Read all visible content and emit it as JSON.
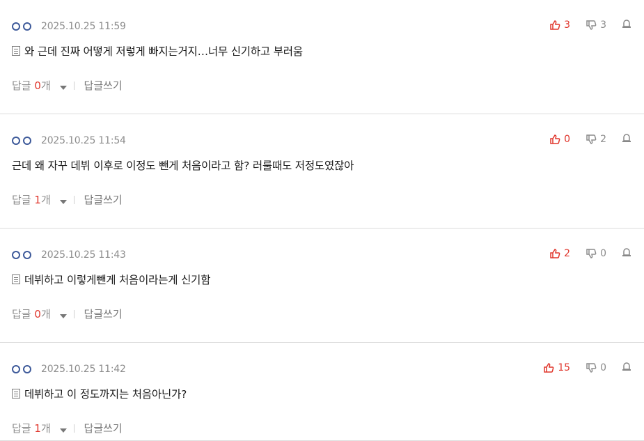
{
  "comments": [
    {
      "date": "2025.10.25 11:59",
      "up": "3",
      "down": "3",
      "text": "와 근데 진짜 어떻게 저렇게 빠지는거지…너무 신기하고 부러움",
      "has_memo_icon": true,
      "reply_label_prefix": "답글",
      "reply_count": "0",
      "reply_label_suffix": "개",
      "write_label": "답글쓰기"
    },
    {
      "date": "2025.10.25 11:54",
      "up": "0",
      "down": "2",
      "text": "근데 왜 자꾸 데뷔 이후로 이정도 뺀게 처음이라고 함? 러룰때도 저정도였잖아",
      "has_memo_icon": false,
      "reply_label_prefix": "답글",
      "reply_count": "1",
      "reply_label_suffix": "개",
      "write_label": "답글쓰기"
    },
    {
      "date": "2025.10.25 11:43",
      "up": "2",
      "down": "0",
      "text": "데뷔하고 이렇게뺀게 처음이라는게 신기함",
      "has_memo_icon": true,
      "reply_label_prefix": "답글",
      "reply_count": "0",
      "reply_label_suffix": "개",
      "write_label": "답글쓰기"
    },
    {
      "date": "2025.10.25 11:42",
      "up": "15",
      "down": "0",
      "text": "데뷔하고 이 정도까지는 처음아닌가?",
      "has_memo_icon": true,
      "reply_label_prefix": "답글",
      "reply_count": "1",
      "reply_label_suffix": "개",
      "write_label": "답글쓰기"
    }
  ],
  "colors": {
    "accent_red": "#e0362c",
    "user_icon_blue": "#3e5a9a",
    "muted_text": "#8c8c8c"
  },
  "icons": {
    "user": "user-circles-icon",
    "upvote": "thumbs-up-icon",
    "downvote": "thumbs-down-icon",
    "report": "report-bell-icon",
    "memo": "memo-icon",
    "caret": "caret-down-icon"
  }
}
